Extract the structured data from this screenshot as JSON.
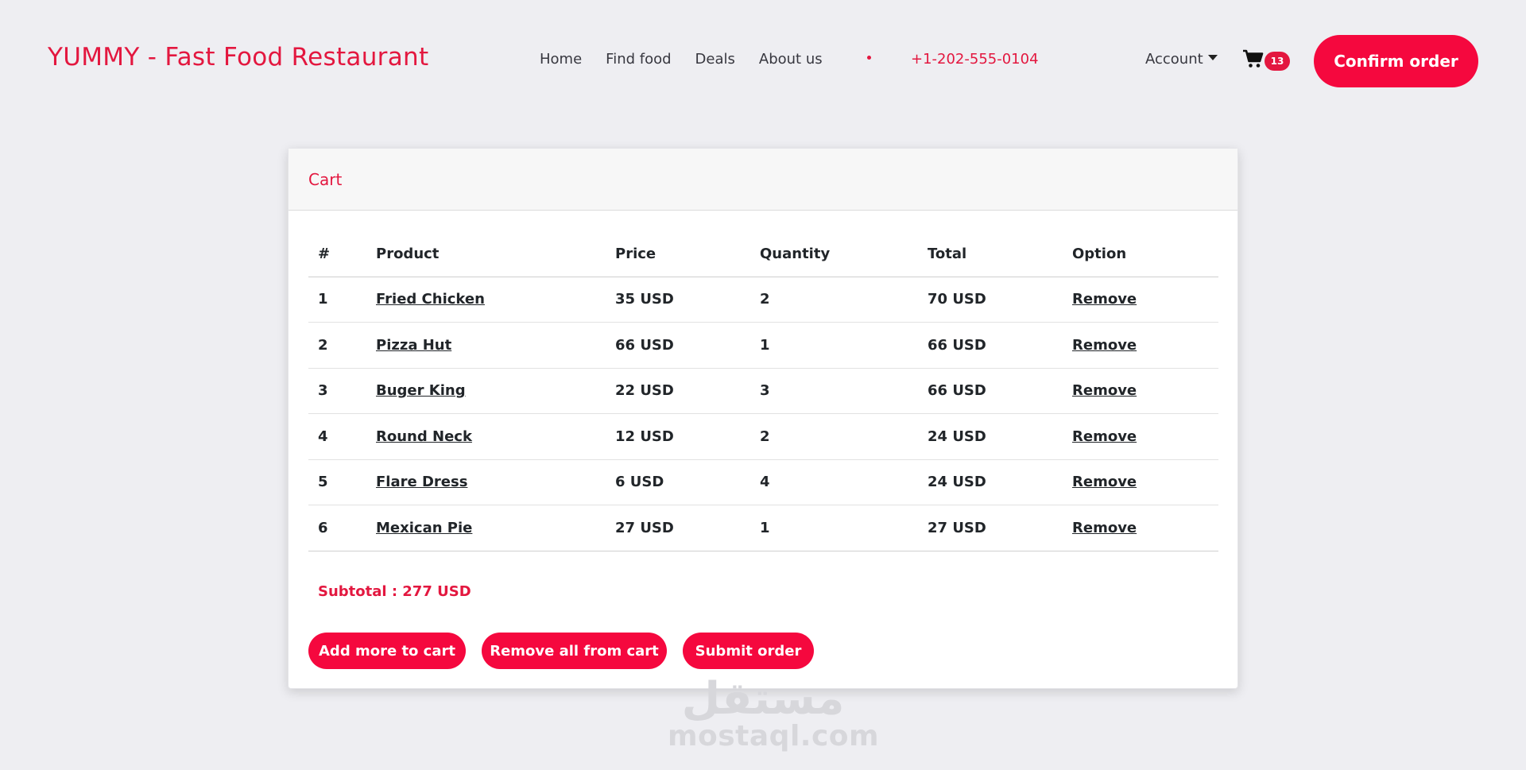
{
  "header": {
    "brand": "YUMMY - Fast Food Restaurant",
    "nav": [
      "Home",
      "Find food",
      "Deals",
      "About us"
    ],
    "phone": "+1-202-555-0104",
    "account_label": "Account",
    "cart_count": "13",
    "confirm_label": "Confirm order"
  },
  "cart": {
    "title": "Cart",
    "columns": [
      "#",
      "Product",
      "Price",
      "Quantity",
      "Total",
      "Option"
    ],
    "rows": [
      {
        "num": "1",
        "product": "Fried Chicken",
        "price": "35 USD",
        "qty": "2",
        "total": "70 USD",
        "option": "Remove"
      },
      {
        "num": "2",
        "product": "Pizza Hut",
        "price": "66 USD",
        "qty": "1",
        "total": "66 USD",
        "option": "Remove"
      },
      {
        "num": "3",
        "product": "Buger King",
        "price": "22 USD",
        "qty": "3",
        "total": "66 USD",
        "option": "Remove"
      },
      {
        "num": "4",
        "product": "Round Neck",
        "price": "12 USD",
        "qty": "2",
        "total": "24 USD",
        "option": "Remove"
      },
      {
        "num": "5",
        "product": "Flare Dress",
        "price": "6 USD",
        "qty": "4",
        "total": "24 USD",
        "option": "Remove"
      },
      {
        "num": "6",
        "product": "Mexican Pie",
        "price": "27 USD",
        "qty": "1",
        "total": "27 USD",
        "option": "Remove"
      }
    ],
    "subtotal": "Subtotal : 277 USD",
    "buttons": {
      "add_more": "Add more to cart",
      "remove_all": "Remove all from cart",
      "submit": "Submit order"
    }
  },
  "watermark": {
    "arabic": "مستقل",
    "latin": "mostaql.com"
  },
  "colors": {
    "accent": "#e3173f",
    "button": "#f5083e",
    "background": "#eeeef2"
  },
  "icons": {
    "cart": "shopping-cart-icon",
    "account_caret": "caret-down-icon"
  }
}
